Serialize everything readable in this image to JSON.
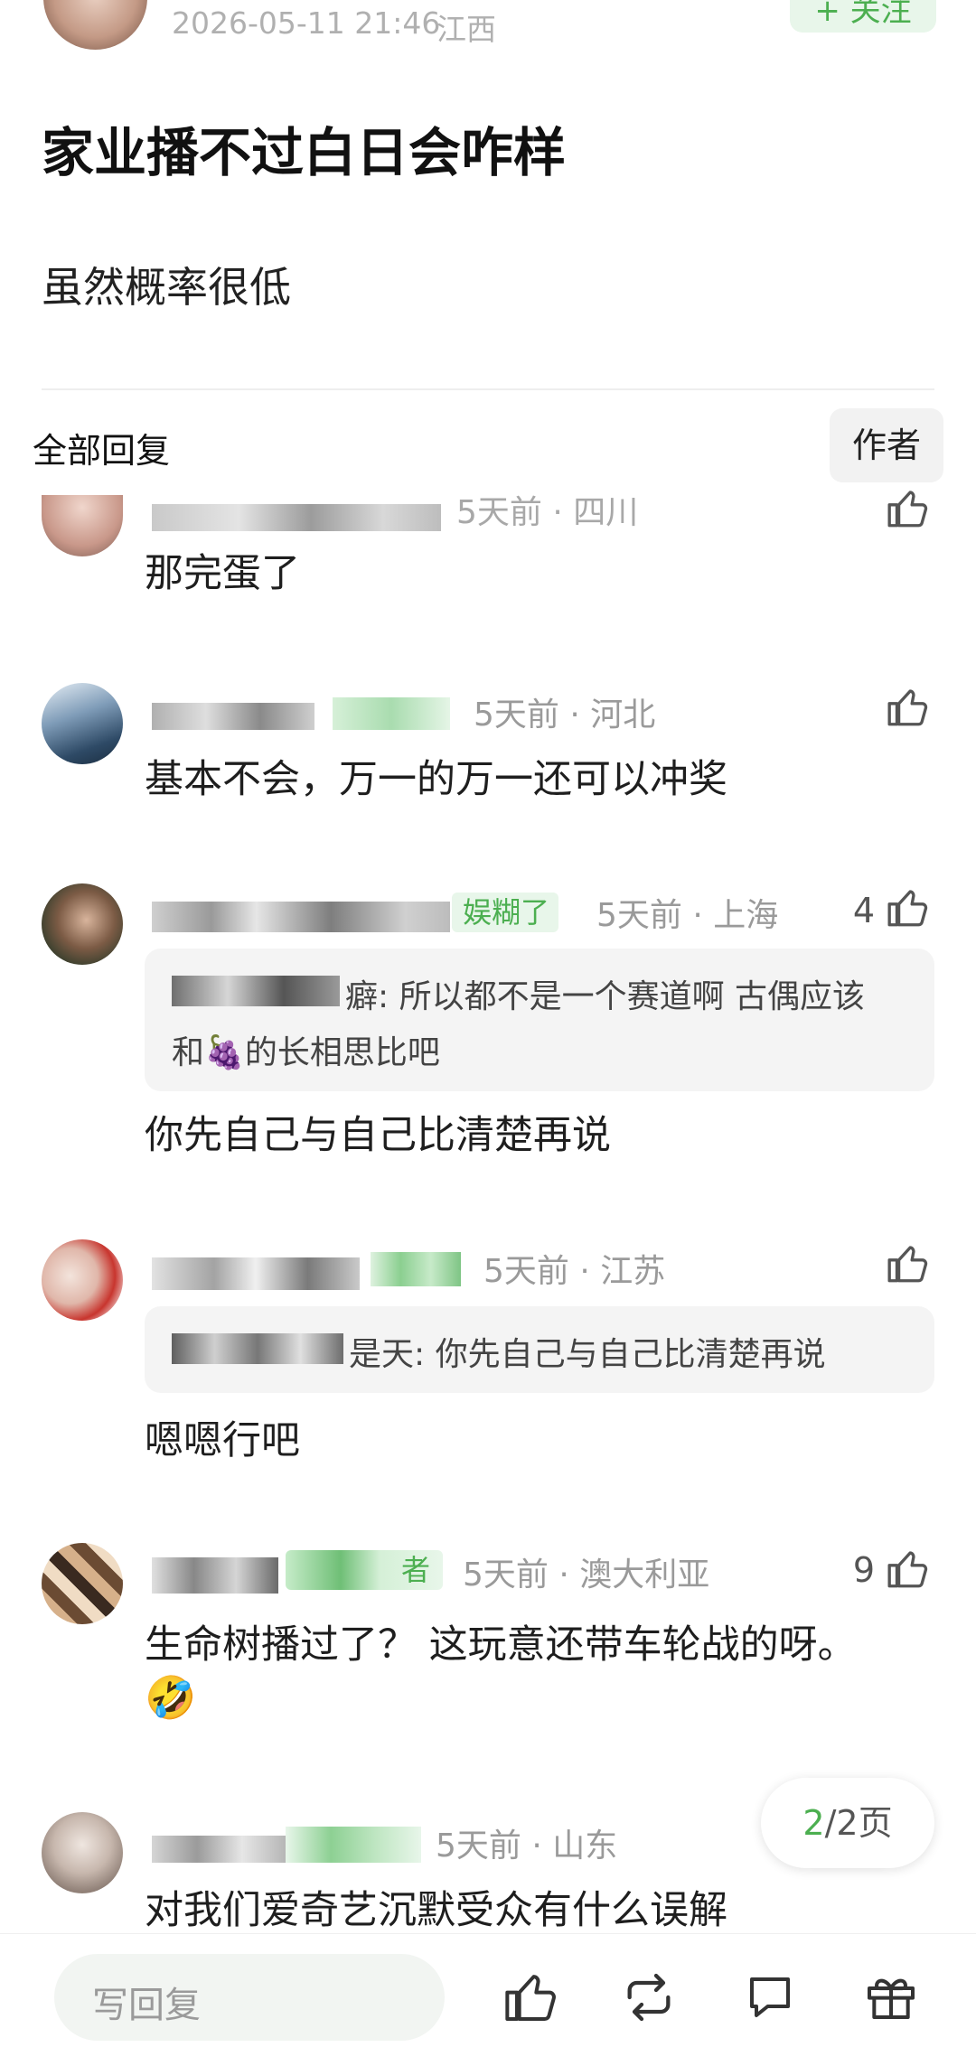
{
  "post": {
    "timestamp": "2026-05-11 21:46",
    "location": "江西",
    "follow_label": "+ 关注",
    "title": "家业播不过白日会咋样",
    "body": "虽然概率很低"
  },
  "tabs": {
    "all_replies": "全部回复",
    "author": "作者"
  },
  "comments": [
    {
      "time": "5天前 · 四川",
      "text": "那完蛋了",
      "likes": ""
    },
    {
      "time": "5天前 · 河北",
      "text": "基本不会，万一的万一还可以冲奖",
      "likes": ""
    },
    {
      "badge": "娱糊了",
      "time": "5天前 · 上海",
      "likes": "4",
      "quote_line1": "癖: 所以都不是一个赛道啊 古偶应该",
      "quote_line2": "和🍇的长相思比吧",
      "text": "你先自己与自己比清楚再说"
    },
    {
      "time": "5天前 · 江苏",
      "likes": "",
      "quote_line1": "是天: 你先自己与自己比清楚再说",
      "text": "嗯嗯行吧"
    },
    {
      "badge": "者",
      "time": "5天前 · 澳大利亚",
      "likes": "9",
      "text": "生命树播过了？ 这玩意还带车轮战的呀。",
      "emoji": "🤣"
    },
    {
      "time": "5天前 · 山东",
      "text": "对我们爱奇艺沉默受众有什么误解",
      "likes": ""
    }
  ],
  "pager": {
    "current": "2",
    "total": "/2页"
  },
  "bottom_bar": {
    "reply_placeholder": "写回复"
  },
  "colors": {
    "accent_green": "#4caf50",
    "follow_bg": "#e8f6ea",
    "muted": "#9a9a9a"
  }
}
